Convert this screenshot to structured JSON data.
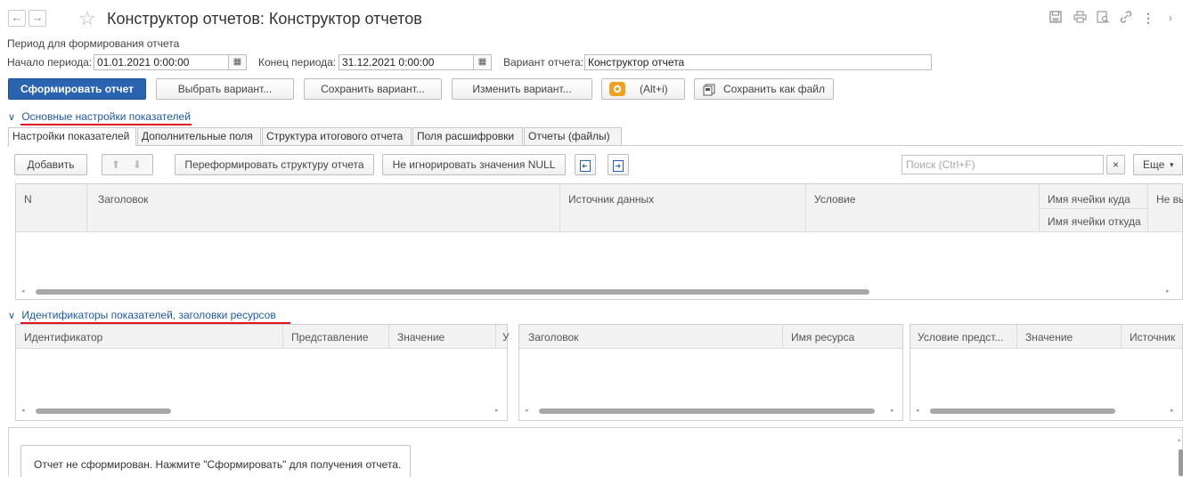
{
  "window": {
    "title": "Конструктор отчетов: Конструктор отчетов",
    "back_glyph": "←",
    "forward_glyph": "→",
    "star_glyph": "☆",
    "toolbar_icons": [
      "save-icon",
      "print-icon",
      "preview-icon",
      "link-icon",
      "more-icon",
      "expand-icon"
    ],
    "more_glyph": "⋮",
    "expand_glyph": "›"
  },
  "period": {
    "group_label": "Период для формирования отчета",
    "start_label": "Начало периода:",
    "start_value": "01.01.2021  0:00:00",
    "end_label": "Конец периода:",
    "end_value": "31.12.2021  0:00:00",
    "variant_label": "Вариант отчета:",
    "variant_value": "Конструктор отчета",
    "calendar_glyph": "▦"
  },
  "toolbar": {
    "generate": "Сформировать отчет",
    "choose_variant": "Выбрать вариант...",
    "save_variant": "Сохранить вариант...",
    "change_variant": "Изменить вариант...",
    "hotkey": "(Alt+i)",
    "save_file": "Сохранить как файл"
  },
  "settings_section": {
    "title": "Основные настройки показателей",
    "tabs": [
      "Настройки показателей",
      "Дополнительные поля",
      "Структура итогового отчета",
      "Поля расшифровки",
      "Отчеты (файлы)"
    ],
    "commands": {
      "add": "Добавить",
      "up_glyph": "⬆",
      "down_glyph": "⬇",
      "reform": "Переформировать структуру отчета",
      "null": "Не игнорировать значения NULL",
      "search_placeholder": "Поиск (Ctrl+F)",
      "clear_glyph": "×",
      "more": "Еще",
      "more_arrow": "▾"
    },
    "columns": {
      "n": "N",
      "header": "Заголовок",
      "source": "Источник данных",
      "condition": "Условие",
      "cell_to": "Имя ячейки куда",
      "cell_from": "Имя ячейки откуда",
      "not_shown": "Не вы"
    }
  },
  "identifiers_section": {
    "title": "Идентификаторы показателей, заголовки ресурсов",
    "grid1": {
      "col1": "Идентификатор",
      "col2": "Представление",
      "col3": "Значение",
      "col4": "У"
    },
    "grid2": {
      "col1": "Заголовок",
      "col2": "Имя ресурса"
    },
    "grid3": {
      "col1": "Условие предст...",
      "col2": "Значение",
      "col3": "Источник"
    }
  },
  "status": {
    "message": "Отчет не сформирован. Нажмите \"Сформировать\" для получения отчета."
  },
  "colors": {
    "accent": "#2a64b1",
    "link": "#1f5aa5",
    "underline": "#e0141e",
    "eye_orange": "#f0a020"
  }
}
